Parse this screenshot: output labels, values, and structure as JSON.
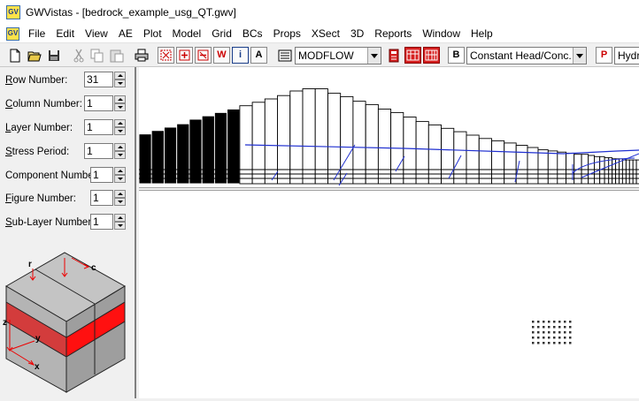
{
  "window": {
    "title": "GWVistas - [bedrock_example_usg_QT.gwv]",
    "icon_text": "GV"
  },
  "menu": {
    "items": [
      "File",
      "Edit",
      "View",
      "AE",
      "Plot",
      "Model",
      "Grid",
      "BCs",
      "Props",
      "XSect",
      "3D",
      "Reports",
      "Window",
      "Help"
    ]
  },
  "toolbar": {
    "buttons": [
      {
        "name": "new-file-icon"
      },
      {
        "name": "open-folder-icon"
      },
      {
        "name": "save-disk-icon"
      },
      {
        "name": "cut-icon"
      },
      {
        "name": "copy-icon"
      },
      {
        "name": "paste-icon"
      },
      {
        "name": "print-icon"
      },
      {
        "name": "zoom-extents-icon"
      },
      {
        "name": "zoom-in-icon"
      },
      {
        "name": "zoom-out-icon"
      },
      {
        "name": "well-icon",
        "letter": "W"
      },
      {
        "name": "info-icon",
        "letter": "i"
      },
      {
        "name": "text-annotation-icon",
        "letter": "A"
      },
      {
        "name": "model-settings-icon"
      },
      {
        "name": "run-model-icon"
      },
      {
        "name": "grid-red-icon"
      },
      {
        "name": "grid-red-2-icon"
      },
      {
        "name": "boundary-condition-icon",
        "letter": "B"
      },
      {
        "name": "property-icon",
        "letter": "P"
      }
    ],
    "model_select": {
      "value": "MODFLOW"
    },
    "bc_select": {
      "value": "Constant Head/Conc."
    },
    "prop_select": {
      "value": "Hydra"
    }
  },
  "fields": [
    {
      "label_u": "R",
      "label_rest": "ow Number:",
      "value": "31"
    },
    {
      "label_u": "C",
      "label_rest": "olumn Number:",
      "value": "1"
    },
    {
      "label_u": "L",
      "label_rest": "ayer Number:",
      "value": "1"
    },
    {
      "label_u": "S",
      "label_rest": "tress Period:",
      "value": "1"
    },
    {
      "label_u": "",
      "label_rest": "Component Number:",
      "value": "1"
    },
    {
      "label_u": "F",
      "label_rest": "igure Number:",
      "value": "1"
    },
    {
      "label_u": "S",
      "label_rest": "ub-Layer Number:",
      "value": "1"
    }
  ],
  "cube": {
    "axis_labels": {
      "r": "r",
      "c": "c",
      "z": "z",
      "y": "y",
      "x": "x"
    },
    "colors": {
      "top": "#c4c4c4",
      "right": "#9e9e9e",
      "left": "#b4b4b4",
      "band_front": "#d33c3c",
      "band_side": "#ff1010"
    }
  },
  "cross_section": {
    "inactive_color": "#000000",
    "active_color": "#ffffff",
    "water_table_color": "#2030d0",
    "column_heights": [
      0.44,
      0.47,
      0.5,
      0.53,
      0.57,
      0.6,
      0.63,
      0.66,
      0.69,
      0.72,
      0.75,
      0.78,
      0.82,
      0.84,
      0.84,
      0.8,
      0.77,
      0.73,
      0.7,
      0.66,
      0.63,
      0.59,
      0.55,
      0.52,
      0.49,
      0.46,
      0.43,
      0.4,
      0.38,
      0.36,
      0.34,
      0.32,
      0.3,
      0.29,
      0.28,
      0.27,
      0.26,
      0.26,
      0.25,
      0.24,
      0.24,
      0.23,
      0.23,
      0.22,
      0.22,
      0.22,
      0.21,
      0.21,
      0.21,
      0.21,
      0.21,
      0.21
    ],
    "inactive_columns": 8
  },
  "plan_view": {
    "dot_grid_color": "#333333"
  }
}
